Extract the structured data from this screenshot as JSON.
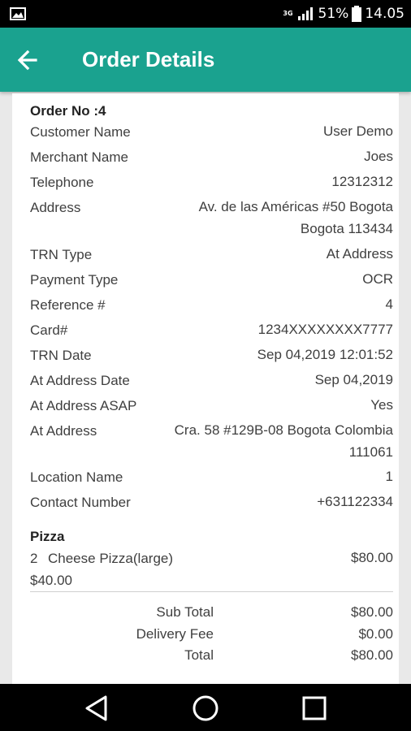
{
  "status_bar": {
    "network": "3G",
    "battery": "51%",
    "time": "14.05",
    "icons": [
      "image-icon",
      "signal-icon",
      "battery-icon"
    ]
  },
  "app_bar": {
    "title": "Order Details",
    "back_icon": "arrow-left-icon",
    "color": "#1aa28f"
  },
  "order": {
    "order_no": "Order No :4",
    "fields": [
      {
        "label": "Customer Name",
        "value": "User Demo"
      },
      {
        "label": "Merchant Name",
        "value": "Joes"
      },
      {
        "label": "Telephone",
        "value": "12312312"
      },
      {
        "label": "Address",
        "value_lines": [
          "Av. de las Américas #50 Bogota",
          "Bogota 113434"
        ]
      },
      {
        "label": "TRN Type",
        "value": "At Address"
      },
      {
        "label": "Payment Type",
        "value": "OCR"
      },
      {
        "label": "Reference #",
        "value": "4"
      },
      {
        "label": "Card#",
        "value": "1234XXXXXXXX7777"
      },
      {
        "label": "TRN Date",
        "value": "Sep 04,2019 12:01:52"
      },
      {
        "label": "At Address Date",
        "value": "Sep 04,2019"
      },
      {
        "label": "At Address ASAP",
        "value": "Yes"
      },
      {
        "label": "At Address",
        "value_lines": [
          "Cra. 58 #129B-08 Bogota Colombia",
          "111061"
        ]
      },
      {
        "label": "Location Name",
        "value": "1"
      },
      {
        "label": "Contact Number",
        "value": "+631122334"
      }
    ]
  },
  "items": {
    "category": "Pizza",
    "list": [
      {
        "qty": "2",
        "name": "Cheese Pizza(large)",
        "total": "$80.00",
        "unit_price": "$40.00"
      }
    ]
  },
  "totals": {
    "sub_total_label": "Sub Total",
    "sub_total": "$80.00",
    "delivery_fee_label": "Delivery Fee",
    "delivery_fee": "$0.00",
    "total_label": "Total",
    "total": "$80.00"
  },
  "nav_bar": {
    "icons": [
      "back-triangle-icon",
      "home-circle-icon",
      "recents-square-icon"
    ]
  }
}
